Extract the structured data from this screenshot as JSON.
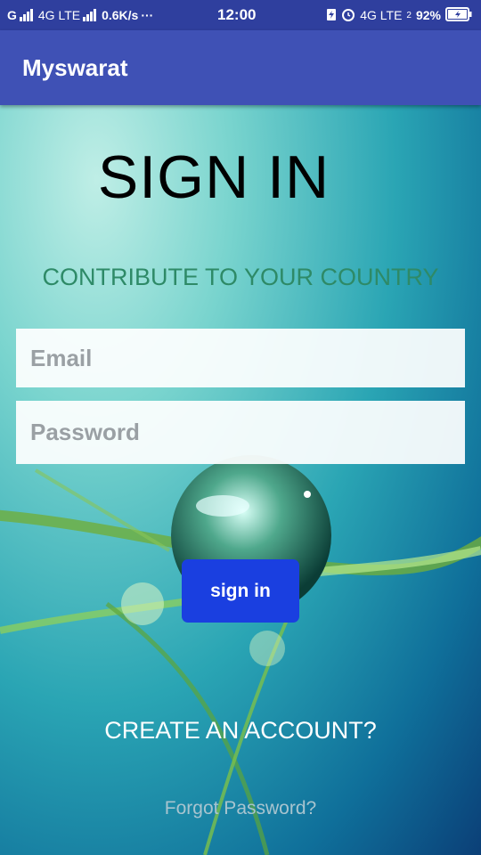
{
  "status_bar": {
    "carrier1": "G",
    "network": "4G LTE",
    "speed": "0.6K/s",
    "dots": "···",
    "time": "12:00",
    "network2": "4G LTE",
    "sim_index": "2",
    "battery": "92%"
  },
  "app_bar": {
    "title": "Myswarat"
  },
  "login": {
    "heading": "SIGN IN",
    "tagline": "CONTRIBUTE TO YOUR COUNTRY",
    "email_placeholder": "Email",
    "password_placeholder": "Password",
    "signin_label": "sign in",
    "create_account": "CREATE AN ACCOUNT?",
    "forgot_password": "Forgot Password?"
  },
  "colors": {
    "status_bar": "#2f3f9e",
    "app_bar": "#3f51b5",
    "signin_button": "#1a3fe0",
    "tagline": "#2e8a67"
  }
}
